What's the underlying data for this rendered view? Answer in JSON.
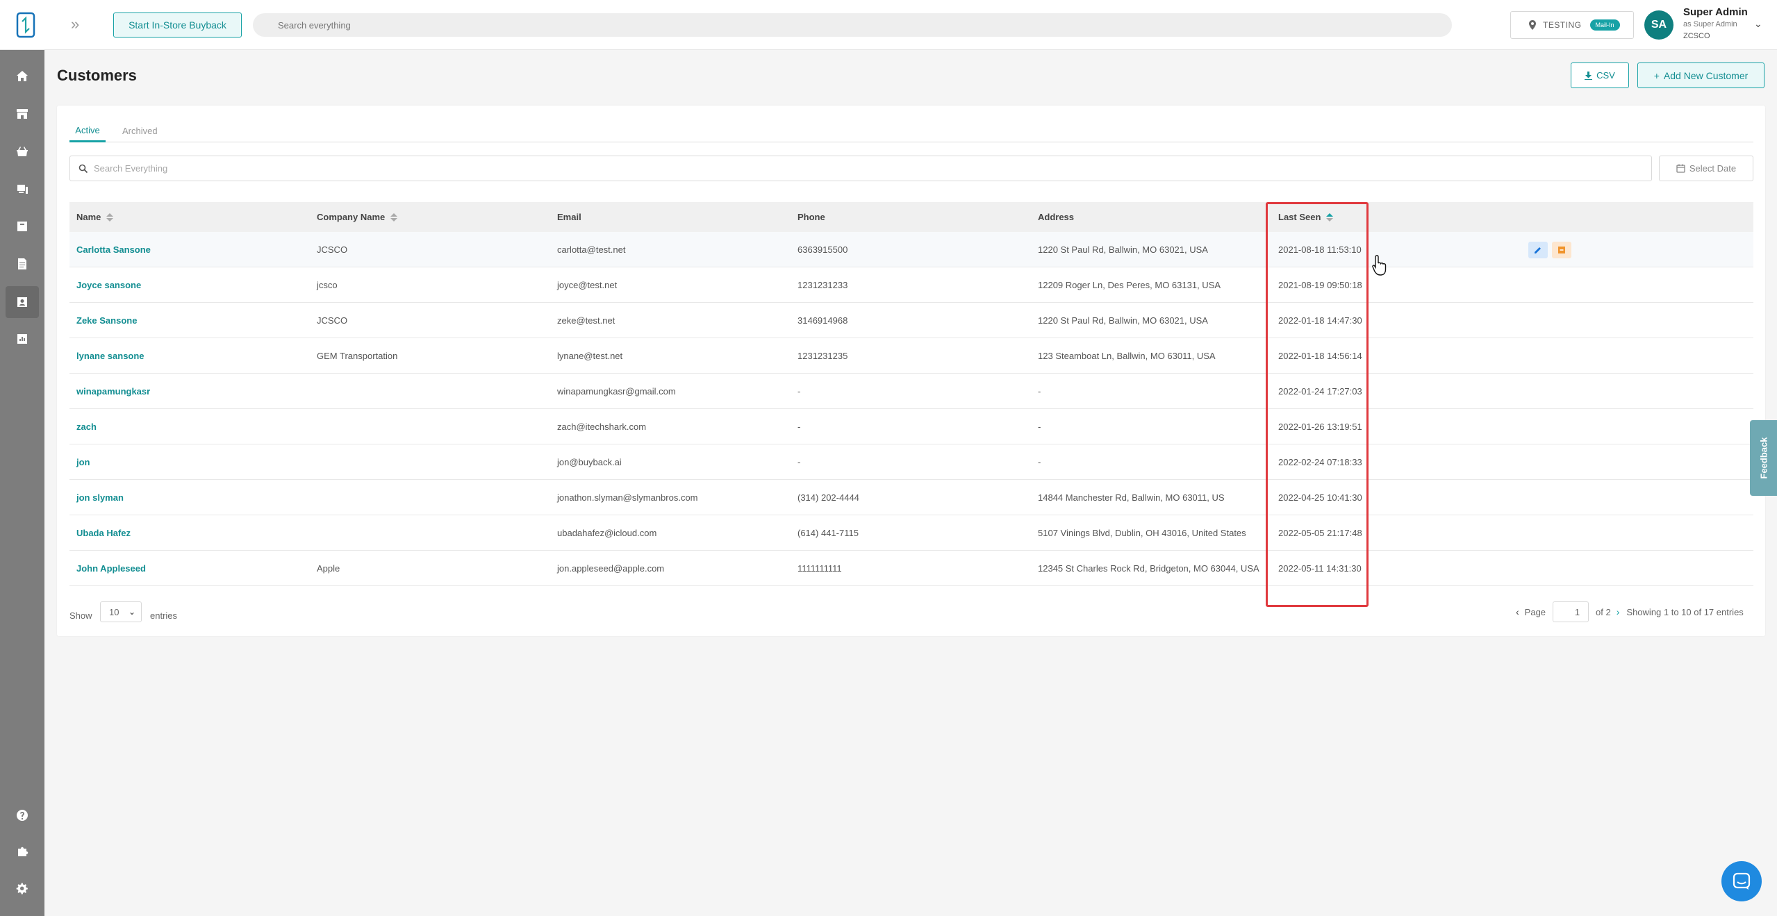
{
  "header": {
    "instore_button": "Start In-Store Buyback",
    "search_placeholder": "Search everything",
    "store_name": "TESTING",
    "store_badge": "Mail-In",
    "user_initials": "SA",
    "user_name": "Super Admin",
    "user_role": "as Super Admin",
    "user_org": "ZCSCO"
  },
  "page": {
    "title": "Customers",
    "csv_label": "CSV",
    "add_label": "Add New Customer"
  },
  "tabs": [
    {
      "label": "Active"
    },
    {
      "label": "Archived"
    }
  ],
  "list_search_placeholder": "Search Everything",
  "date_button": "Select Date",
  "table": {
    "columns": [
      "Name",
      "Company Name",
      "Email",
      "Phone",
      "Address",
      "Last Seen"
    ],
    "rows": [
      {
        "name": "Carlotta Sansone",
        "company": "JCSCO",
        "email": "carlotta@test.net",
        "phone": "6363915500",
        "address": "1220 St Paul Rd, Ballwin, MO 63021, USA",
        "last_seen": "2021-08-18 11:53:10"
      },
      {
        "name": "Joyce sansone",
        "company": "jcsco",
        "email": "joyce@test.net",
        "phone": "1231231233",
        "address": "12209 Roger Ln, Des Peres, MO 63131, USA",
        "last_seen": "2021-08-19 09:50:18"
      },
      {
        "name": "Zeke Sansone",
        "company": "JCSCO",
        "email": "zeke@test.net",
        "phone": "3146914968",
        "address": "1220 St Paul Rd, Ballwin, MO 63021, USA",
        "last_seen": "2022-01-18 14:47:30"
      },
      {
        "name": "lynane sansone",
        "company": "GEM Transportation",
        "email": "lynane@test.net",
        "phone": "1231231235",
        "address": "123 Steamboat Ln, Ballwin, MO 63011, USA",
        "last_seen": "2022-01-18 14:56:14"
      },
      {
        "name": "winapamungkasr",
        "company": "",
        "email": "winapamungkasr@gmail.com",
        "phone": "-",
        "address": "-",
        "last_seen": "2022-01-24 17:27:03"
      },
      {
        "name": "zach",
        "company": "",
        "email": "zach@itechshark.com",
        "phone": "-",
        "address": "-",
        "last_seen": "2022-01-26 13:19:51"
      },
      {
        "name": "jon",
        "company": "",
        "email": "jon@buyback.ai",
        "phone": "-",
        "address": "-",
        "last_seen": "2022-02-24 07:18:33"
      },
      {
        "name": "jon slyman",
        "company": "",
        "email": "jonathon.slyman@slymanbros.com",
        "phone": "(314) 202-4444",
        "address": "14844 Manchester Rd, Ballwin, MO 63011, US",
        "last_seen": "2022-04-25 10:41:30"
      },
      {
        "name": "Ubada Hafez",
        "company": "",
        "email": "ubadahafez@icloud.com",
        "phone": "(614) 441-7115",
        "address": "5107 Vinings Blvd, Dublin, OH 43016, United States",
        "last_seen": "2022-05-05 21:17:48"
      },
      {
        "name": "John Appleseed",
        "company": "Apple",
        "email": "jon.appleseed@apple.com",
        "phone": "1111111111",
        "address": "12345 St Charles Rock Rd, Bridgeton, MO 63044, USA",
        "last_seen": "2022-05-11 14:31:30"
      }
    ]
  },
  "footer": {
    "show_label": "Show",
    "page_size": "10",
    "entries_label": "entries",
    "page_label": "Page",
    "page_value": "1",
    "of_label": "of 2",
    "showing": "Showing 1 to 10 of 17 entries"
  },
  "feedback_label": "Feedback",
  "colors": {
    "accent": "#17a2a6",
    "sidebar": "#7d7d7d",
    "highlight": "#e0393e"
  }
}
